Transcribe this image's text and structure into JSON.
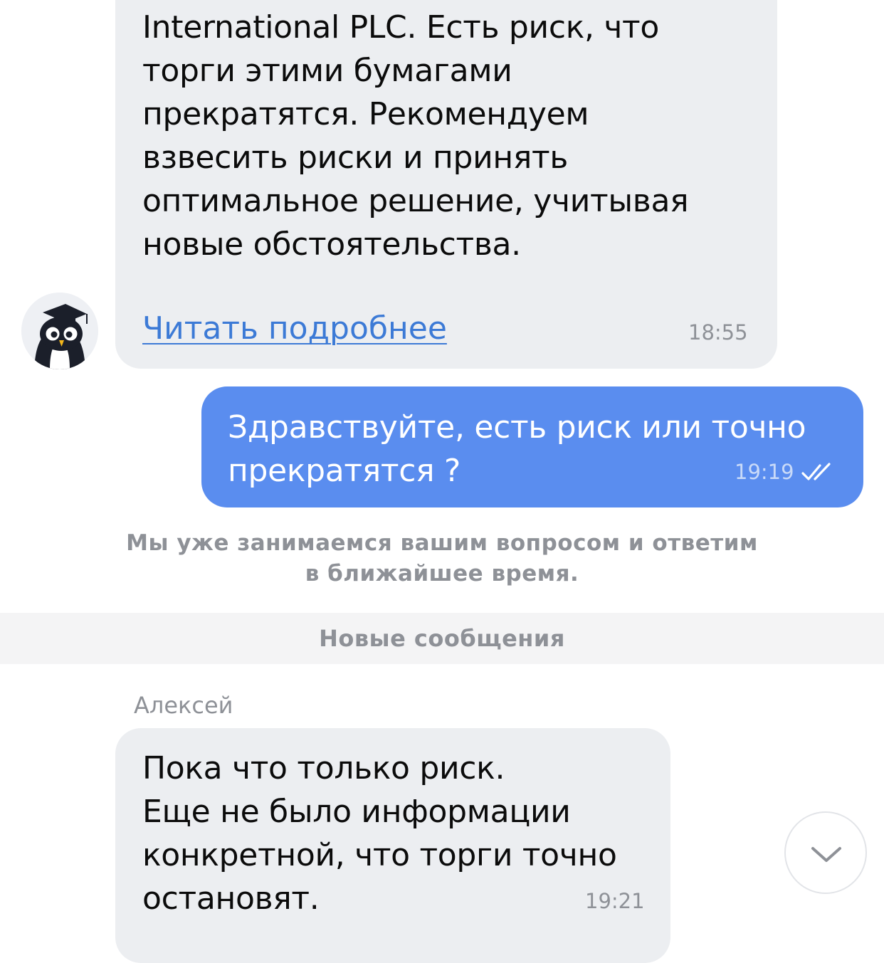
{
  "messages": {
    "first": {
      "lines": [
        "International PLC. Есть риск, что",
        "торги этими бумагами",
        "прекратятся. Рекомендуем",
        "взвесить риски и принять",
        "оптимальное решение, учитывая",
        "новые обстоятельства."
      ],
      "link": "Читать подробнее",
      "time": "18:55"
    },
    "outgoing": {
      "lines": [
        "Здравствуйте, есть риск или точно",
        "прекратятся ?"
      ],
      "time": "19:19"
    },
    "system_note": {
      "lines": [
        "Мы уже занимаемся вашим вопросом и ответим",
        "в ближайшее время."
      ]
    },
    "divider_label": "Новые сообщения",
    "reply": {
      "sender": "Алексей",
      "lines": [
        "Пока что только риск.",
        "Еще не было информации",
        "конкретной, что торги точно",
        "остановят."
      ],
      "time": "19:21"
    }
  },
  "icons": {
    "avatar": "owl-avatar-icon",
    "read_status": "double-check-icon",
    "scroll_down": "chevron-down-icon"
  },
  "colors": {
    "incoming_bubble": "#eceef1",
    "outgoing_bubble": "#5a8def",
    "link": "#3c7ad6",
    "meta_text": "#8e9197"
  }
}
